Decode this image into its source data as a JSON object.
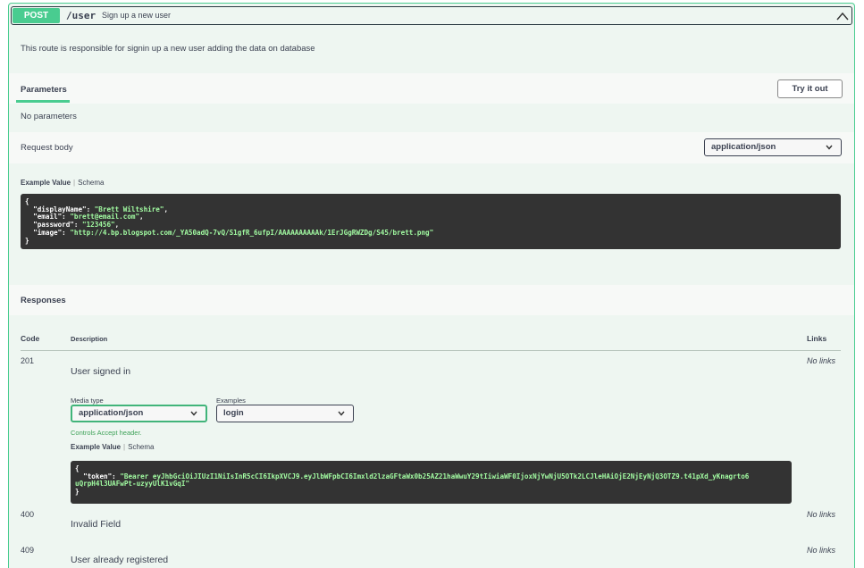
{
  "summary": {
    "method": "POST",
    "path": "/user",
    "description": "Sign up a new user"
  },
  "description": "This route is responsible for signin up a new user adding the data on database",
  "parameters": {
    "title": "Parameters",
    "try_it_out": "Try it out",
    "empty_text": "No parameters"
  },
  "request_body": {
    "label": "Request body",
    "content_type": "application/json",
    "example_value_tab": "Example Value",
    "schema_tab": "Schema",
    "example_lines": [
      {
        "pre": "{",
        "key": "",
        "val": "",
        "post": ""
      },
      {
        "pre": "  ",
        "key": "\"displayName\": ",
        "val": "\"Brett Wiltshire\"",
        "post": ","
      },
      {
        "pre": "  ",
        "key": "\"email\": ",
        "val": "\"brett@email.com\"",
        "post": ","
      },
      {
        "pre": "  ",
        "key": "\"password\": ",
        "val": "\"123456\"",
        "post": ","
      },
      {
        "pre": "  ",
        "key": "\"image\": ",
        "val": "\"http://4.bp.blogspot.com/_YA50adQ-7vQ/S1gfR_6ufpI/AAAAAAAAAAk/1ErJGgRWZDg/S45/brett.png\"",
        "post": ""
      },
      {
        "pre": "}",
        "key": "",
        "val": "",
        "post": ""
      }
    ]
  },
  "responses": {
    "title": "Responses",
    "columns": {
      "code": "Code",
      "description": "Description",
      "links": "Links"
    },
    "items": [
      {
        "code": "201",
        "description": "User signed in",
        "links": "No links",
        "media_type_label": "Media type",
        "media_type": "application/json",
        "controls_text": "Controls Accept header.",
        "examples_label": "Examples",
        "example_selected": "login",
        "example_value_tab": "Example Value",
        "schema_tab": "Schema",
        "example_lines": [
          {
            "pre": "{",
            "key": "",
            "val": "",
            "post": ""
          },
          {
            "pre": "  ",
            "key": "\"token\": ",
            "val": "\"Bearer eyJhbGciOiJIUzI1NiIsInR5cCI6IkpXVCJ9.eyJlbWFpbCI6Imxld2lzaGFtaWx0b25AZ21haWwuY29tIiwiaWF0IjoxNjYwNjU5OTk2LCJleHAiOjE2NjEyNjQ3OTZ9.t41pXd_yKnagrto6",
            "post": ""
          },
          {
            "pre": "",
            "key": "",
            "val": "uQrpH4l3UAFwPt-uzyyUlK1vGqI\"",
            "post": ""
          },
          {
            "pre": "}",
            "key": "",
            "val": "",
            "post": ""
          }
        ]
      },
      {
        "code": "400",
        "description": "Invalid Field",
        "links": "No links"
      },
      {
        "code": "409",
        "description": "User already registered",
        "links": "No links"
      }
    ]
  },
  "colors": {
    "post_green": "#49cc90",
    "block_bg": "#eef6f1",
    "code_bg": "#333333",
    "string_green": "#a2fca2"
  }
}
